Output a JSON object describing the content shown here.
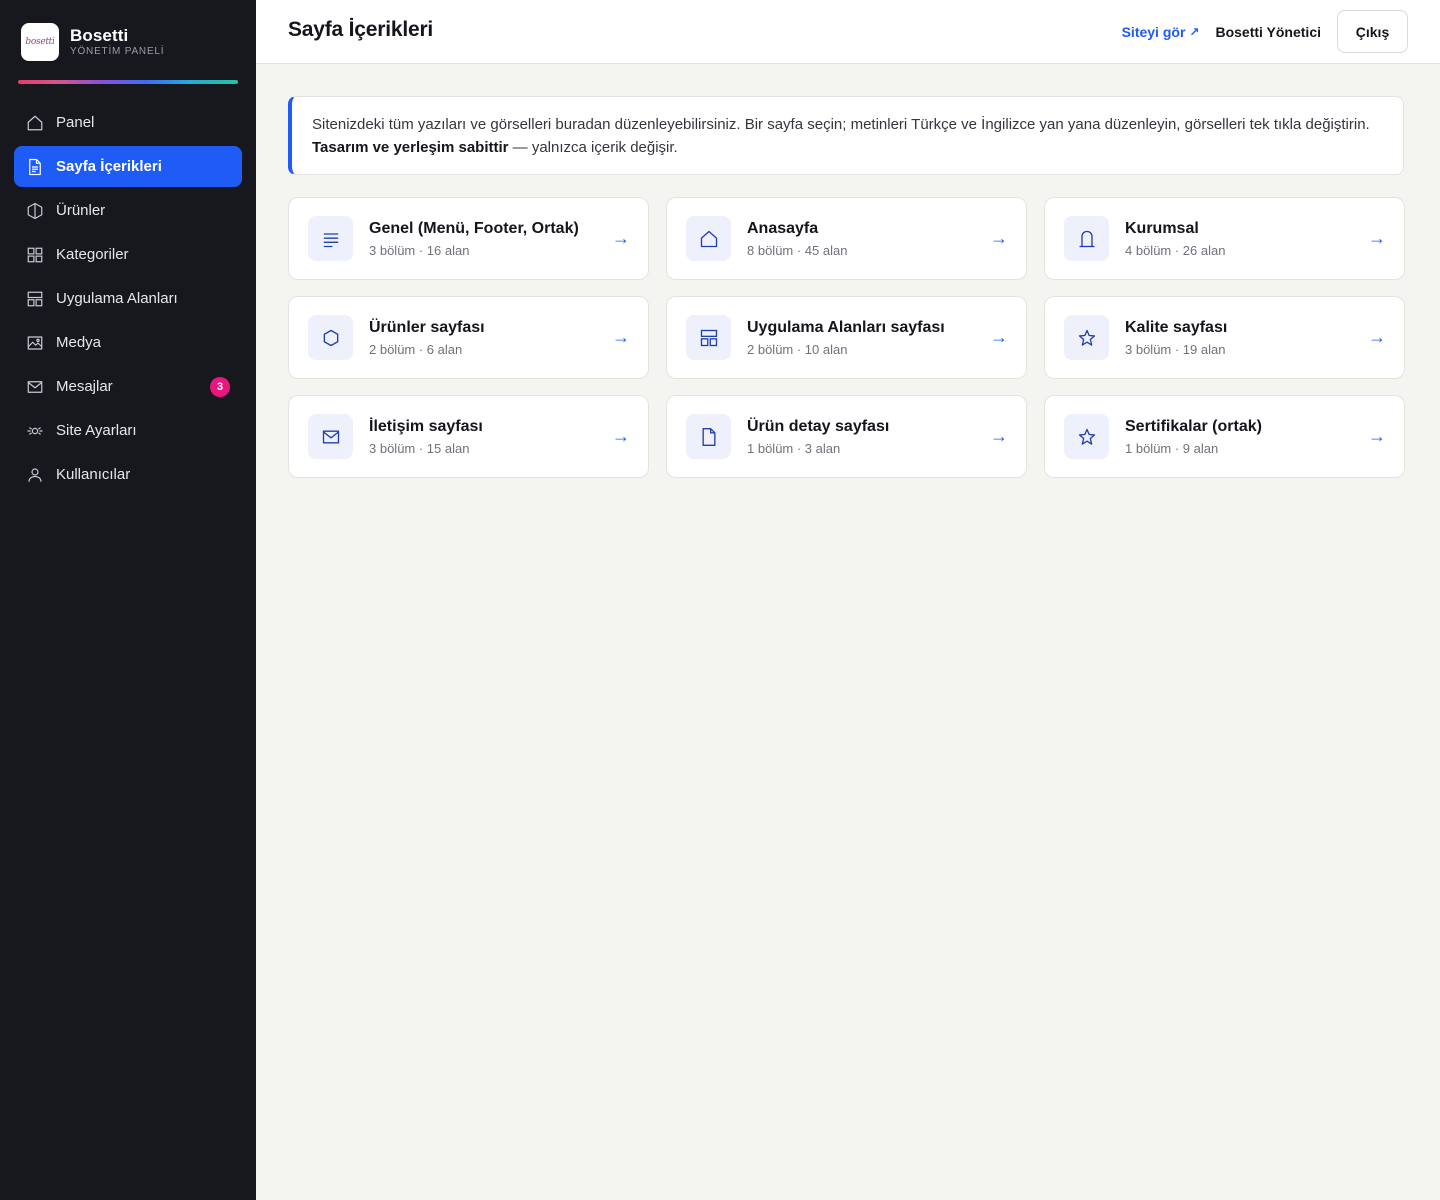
{
  "brand": {
    "logo_text": "bosetti",
    "name": "Bosetti",
    "subtitle": "YÖNETİM PANELİ"
  },
  "sidebar": {
    "items": [
      {
        "label": "Panel",
        "icon": "home-icon"
      },
      {
        "label": "Sayfa İçerikleri",
        "icon": "document-icon",
        "active": true
      },
      {
        "label": "Ürünler",
        "icon": "cube-icon"
      },
      {
        "label": "Kategoriler",
        "icon": "grid-icon"
      },
      {
        "label": "Uygulama Alanları",
        "icon": "layout-icon"
      },
      {
        "label": "Medya",
        "icon": "image-icon"
      },
      {
        "label": "Mesajlar",
        "icon": "mail-icon",
        "badge": "3"
      },
      {
        "label": "Site Ayarları",
        "icon": "settings-icon"
      },
      {
        "label": "Kullanıcılar",
        "icon": "user-icon"
      }
    ]
  },
  "header": {
    "title": "Sayfa İçerikleri",
    "site_link": "Siteyi gör",
    "site_link_arrow": "↗",
    "user": "Bosetti Yönetici",
    "logout": "Çıkış"
  },
  "info": {
    "text_1": "Sitenizdeki tüm yazıları ve görselleri buradan düzenleyebilirsiniz. Bir sayfa seçin; metinleri Türkçe ve İngilizce yan yana düzenleyin, görselleri tek tıkla değiştirin. ",
    "bold": "Tasarım ve yerleşim sabittir",
    "text_2": " — yalnızca içerik değişir."
  },
  "cards": [
    {
      "title": "Genel (Menü, Footer, Ortak)",
      "meta": "3 bölüm · 16 alan",
      "icon": "lines-icon"
    },
    {
      "title": "Anasayfa",
      "meta": "8 bölüm · 45 alan",
      "icon": "home-icon"
    },
    {
      "title": "Kurumsal",
      "meta": "4 bölüm · 26 alan",
      "icon": "building-icon"
    },
    {
      "title": "Ürünler sayfası",
      "meta": "2 bölüm · 6 alan",
      "icon": "hexagon-icon"
    },
    {
      "title": "Uygulama Alanları sayfası",
      "meta": "2 bölüm · 10 alan",
      "icon": "layout-icon"
    },
    {
      "title": "Kalite sayfası",
      "meta": "3 bölüm · 19 alan",
      "icon": "star-icon"
    },
    {
      "title": "İletişim sayfası",
      "meta": "3 bölüm · 15 alan",
      "icon": "mail-icon"
    },
    {
      "title": "Ürün detay sayfası",
      "meta": "1 bölüm · 3 alan",
      "icon": "file-icon"
    },
    {
      "title": "Sertifikalar (ortak)",
      "meta": "1 bölüm · 9 alan",
      "icon": "star-icon"
    }
  ],
  "card_arrow": "→",
  "colors": {
    "accent": "#1f5cf5",
    "sidebar_bg": "#16181e",
    "badge": "#e8177d",
    "page_bg": "#f4f4f1"
  }
}
